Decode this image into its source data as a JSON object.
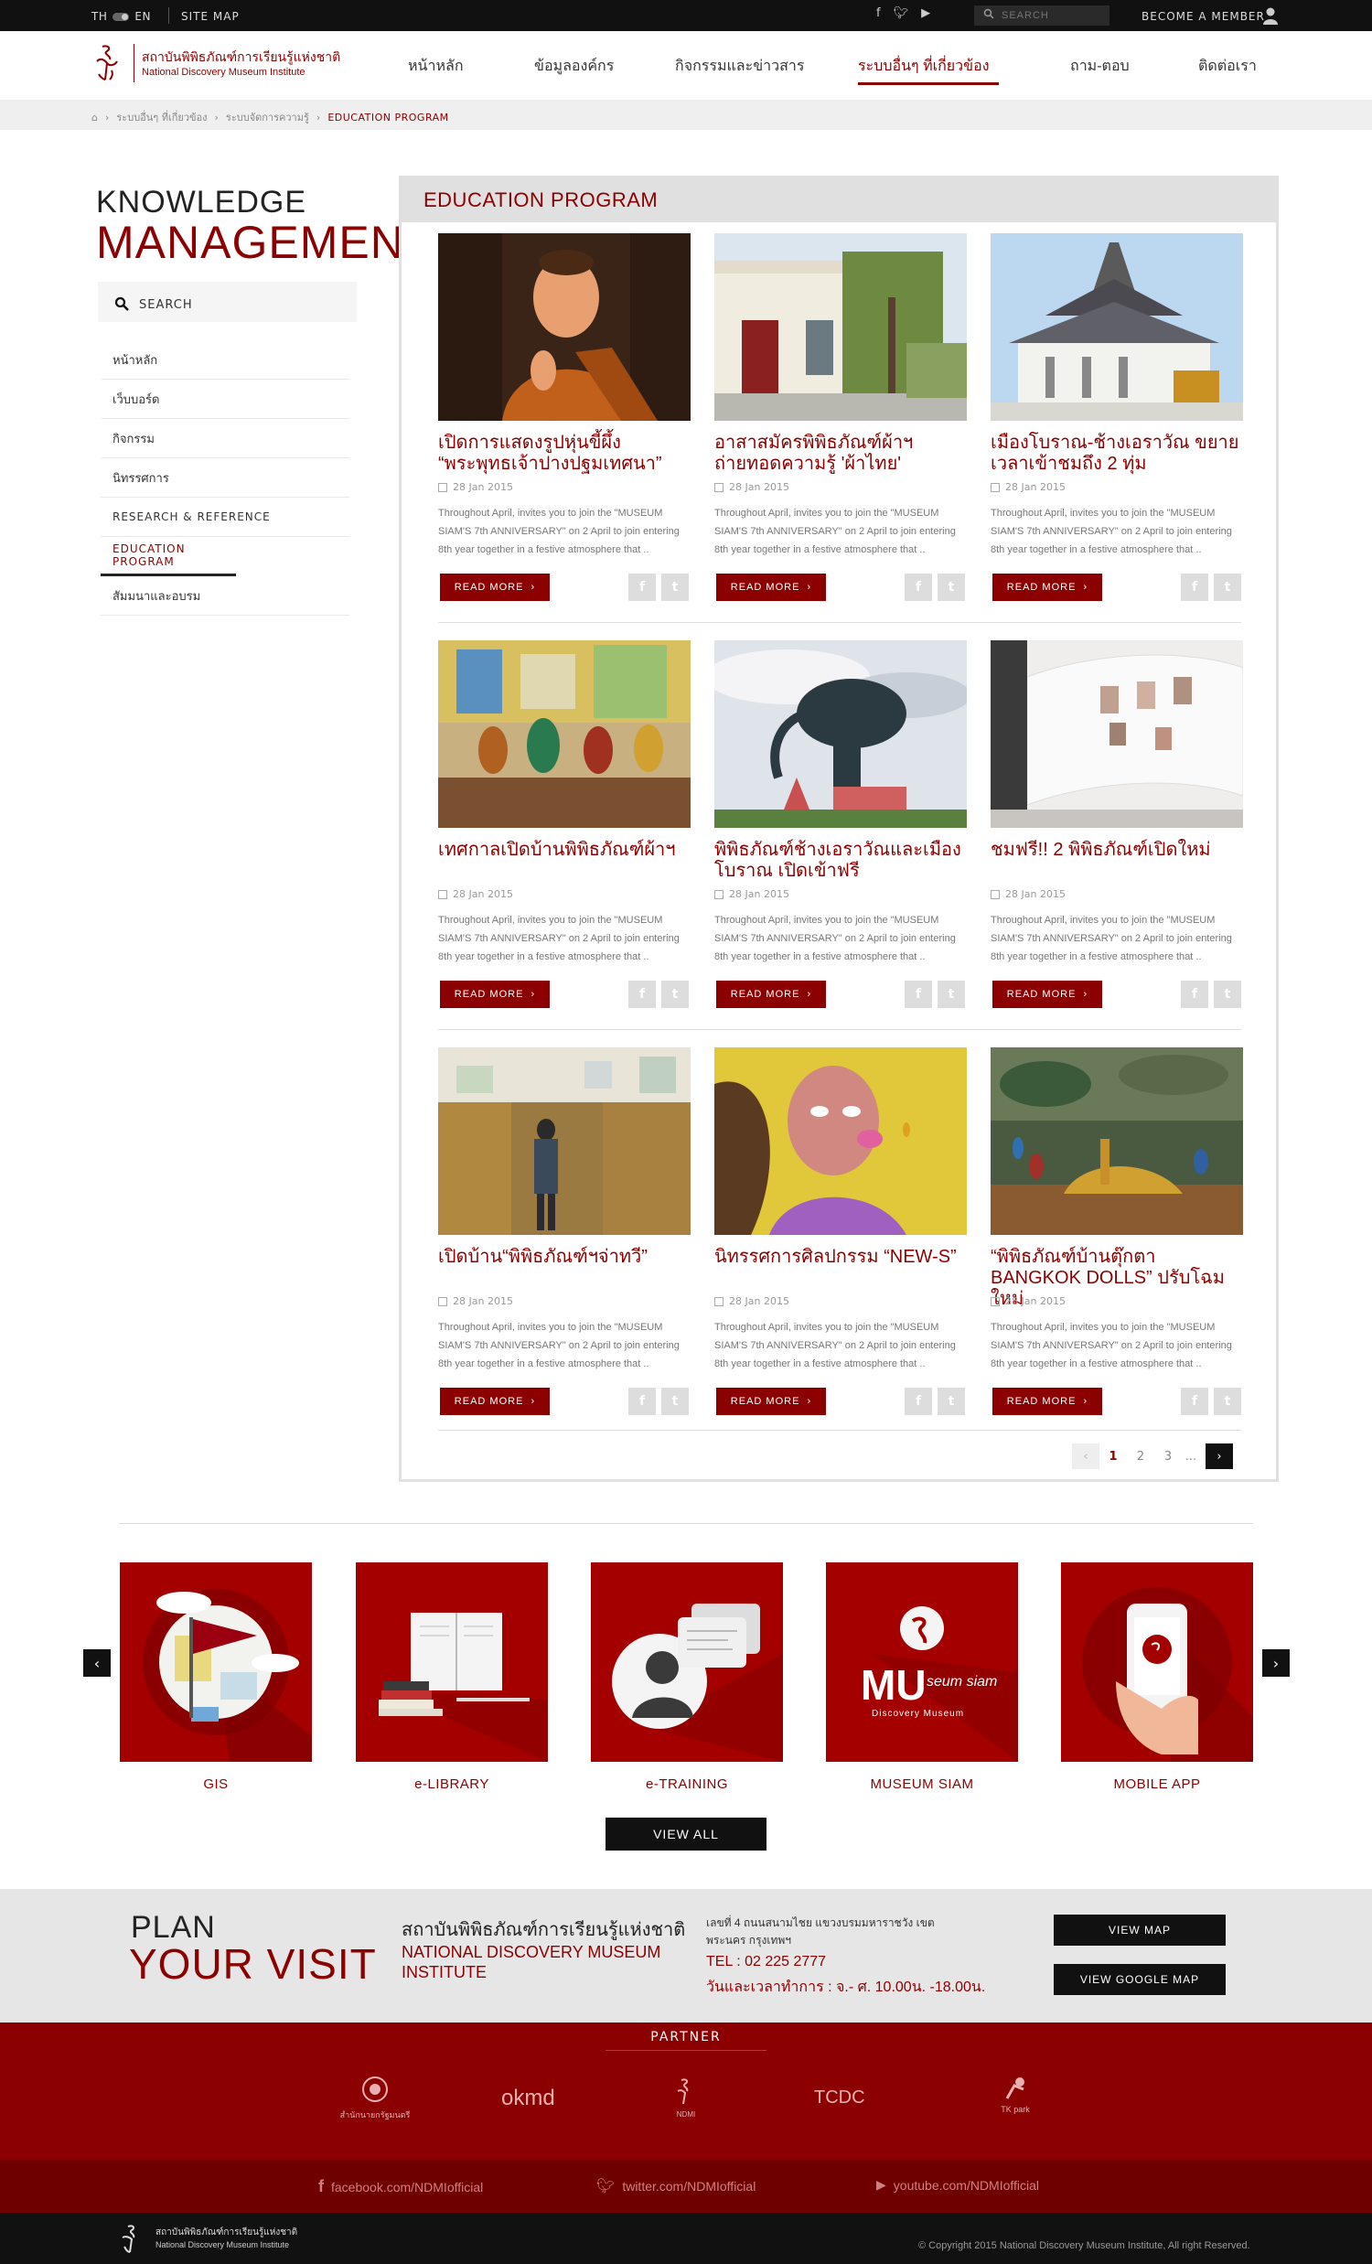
{
  "topbar": {
    "lang_th": "TH",
    "lang_en": "EN",
    "sitemap": "SITE MAP",
    "search_placeholder": "SEARCH",
    "member": "BECOME A MEMBER",
    "social_icons": [
      "facebook-icon",
      "twitter-icon",
      "youtube-icon"
    ]
  },
  "header": {
    "logo_th": "สถาบันพิพิธภัณฑ์การเรียนรู้แห่งชาติ",
    "logo_en": "National Discovery Museum Institute",
    "nav": [
      "หน้าหลัก",
      "ข้อมูลองค์กร",
      "กิจกรรมและข่าวสาร",
      "ระบบอื่นๆ ที่เกี่ยวข้อง",
      "ถาม-ตอบ",
      "ติดต่อเรา"
    ],
    "active_nav": "ระบบอื่นๆ ที่เกี่ยวข้อง"
  },
  "breadcrumb": [
    "ระบบอื่นๆ ที่เกี่ยวข้อง",
    "ระบบจัดการความรู้",
    "EDUCATION PROGRAM"
  ],
  "sidebar": {
    "title1": "KNOWLEDGE",
    "title2": "MANAGEMENT",
    "search_label": "SEARCH",
    "items": [
      "หน้าหลัก",
      "เว็บบอร์ด",
      "กิจกรรม",
      "นิทรรศการ",
      "RESEARCH & REFERENCE",
      "EDUCATION PROGRAM",
      "สัมมนาและอบรม"
    ]
  },
  "main": {
    "title": "EDUCATION PROGRAM",
    "read_more": "READ MORE",
    "cards": [
      {
        "title": "เปิดการแสดงรูปหุ่นขี้ผึ้ง “พระพุทธเจ้าปางปฐมเทศนา”",
        "date": "28 Jan 2015",
        "desc": "Throughout April, invites you to join the \"MUSEUM SIAM'S 7th ANNIVERSARY\" on 2 April to join entering 8th year together in a festive atmosphere that .."
      },
      {
        "title": "อาสาสมัครพิพิธภัณฑ์ผ้าฯ ถ่ายทอดความรู้ 'ผ้าไทย'",
        "date": "28 Jan 2015",
        "desc": "Throughout April, invites you to join the \"MUSEUM SIAM'S 7th ANNIVERSARY\" on 2 April to join entering 8th year together in a festive atmosphere that .."
      },
      {
        "title": "เมืองโบราณ-ช้างเอราวัณ ขยายเวลาเข้าชมถึง 2 ทุ่ม",
        "date": "28 Jan 2015",
        "desc": "Throughout April, invites you to join the \"MUSEUM SIAM'S 7th ANNIVERSARY\" on 2 April to join entering 8th year together in a festive atmosphere that .."
      },
      {
        "title": "เทศกาลเปิดบ้านพิพิธภัณฑ์ผ้าฯ",
        "date": "28 Jan 2015",
        "desc": "Throughout April, invites you to join the \"MUSEUM SIAM'S 7th ANNIVERSARY\" on 2 April to join entering 8th year together in a festive atmosphere that .."
      },
      {
        "title": "พิพิธภัณฑ์ช้างเอราวัณและเมืองโบราณ เปิดเข้าฟรี",
        "date": "28 Jan 2015",
        "desc": "Throughout April, invites you to join the \"MUSEUM SIAM'S 7th ANNIVERSARY\" on 2 April to join entering 8th year together in a festive atmosphere that .."
      },
      {
        "title": "ชมฟรี!! 2 พิพิธภัณฑ์เปิดใหม่",
        "date": "28 Jan 2015",
        "desc": "Throughout April, invites you to join the \"MUSEUM SIAM'S 7th ANNIVERSARY\" on 2 April to join entering 8th year together in a festive atmosphere that .."
      },
      {
        "title": "เปิดบ้าน“พิพิธภัณฑ์ฯจ่าทวี”",
        "date": "28 Jan 2015",
        "desc": "Throughout April, invites you to join the \"MUSEUM SIAM'S 7th ANNIVERSARY\" on 2 April to join entering 8th year together in a festive atmosphere that .."
      },
      {
        "title": "นิทรรศการศิลปกรรม “NEW-S”",
        "date": "28 Jan 2015",
        "desc": "Throughout April, invites you to join the \"MUSEUM SIAM'S 7th ANNIVERSARY\" on 2 April to join entering 8th year together in a festive atmosphere that .."
      },
      {
        "title": "“พิพิธภัณฑ์บ้านตุ๊กตา BANGKOK DOLLS” ปรับโฉมใหม่",
        "date": "28 Jan 2015",
        "desc": "Throughout April, invites you to join the \"MUSEUM SIAM'S 7th ANNIVERSARY\" on 2 April to join entering 8th year together in a festive atmosphere that .."
      }
    ],
    "pagination": {
      "pages": [
        "1",
        "2",
        "3",
        "..."
      ],
      "current": "1"
    }
  },
  "services": {
    "items": [
      "GIS",
      "e-LIBRARY",
      "e-TRAINING",
      "MUSEUM SIAM",
      "MOBILE APP"
    ],
    "view_all": "VIEW ALL",
    "museum_logo_text1": "MU",
    "museum_logo_text2": "seum siam",
    "museum_logo_text3": "Discovery Museum"
  },
  "plan": {
    "title1": "PLAN",
    "title2": "YOUR VISIT",
    "org_th": "สถาบันพิพิธภัณฑ์การเรียนรู้แห่งชาติ",
    "org_en": "NATIONAL DISCOVERY MUSEUM INSTITUTE",
    "address": "เลขที่ 4 ถนนสนามไชย แขวงบรมมหาราชวัง เขตพระนคร กรุงเทพฯ",
    "tel": "TEL : 02 225 2777",
    "hours": "วันและเวลาทำการ : จ.- ศ. 10.00น. -18.00น.",
    "btn_map": "VIEW MAP",
    "btn_gmap": "VIEW GOOGLE MAP"
  },
  "partner": {
    "title": "PARTNER",
    "logos": [
      "สำนักนายกรัฐมนตรี",
      "okmd",
      "NDMI",
      "TCDC",
      "TK park"
    ]
  },
  "social": {
    "facebook": "facebook.com/NDMIofficial",
    "twitter": "twitter.com/NDMIofficial",
    "youtube": "youtube.com/NDMIofficial"
  },
  "footer": {
    "logo_th": "สถาบันพิพิธภัณฑ์การเรียนรู้แห่งชาติ",
    "logo_en": "National Discovery Museum Institute",
    "copyright": "© Copyright 2015 National Discovery Museum Institute, All right Reserved."
  },
  "colors": {
    "brand": "#8b0000",
    "dark": "#111111",
    "service_red": "#a50000"
  }
}
